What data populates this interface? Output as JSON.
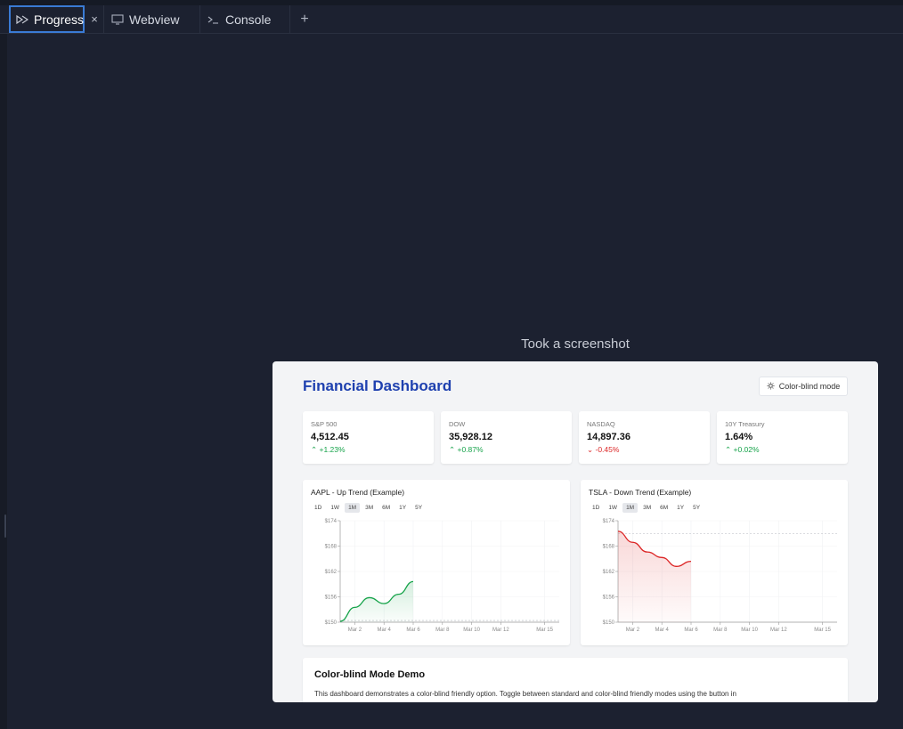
{
  "tabs": {
    "progress": "Progress",
    "webview": "Webview",
    "console": "Console",
    "close": "×",
    "add": "+"
  },
  "caption": "Took a screenshot",
  "dashboard": {
    "title": "Financial Dashboard",
    "colorblind_button": "Color-blind mode",
    "cards": [
      {
        "name": "S&P 500",
        "value": "4,512.45",
        "change": "+1.23%",
        "direction": "up"
      },
      {
        "name": "DOW",
        "value": "35,928.12",
        "change": "+0.87%",
        "direction": "up"
      },
      {
        "name": "NASDAQ",
        "value": "14,897.36",
        "change": "-0.45%",
        "direction": "down"
      },
      {
        "name": "10Y Treasury",
        "value": "1.64%",
        "change": "+0.02%",
        "direction": "up"
      }
    ],
    "ranges": [
      "1D",
      "1W",
      "1M",
      "3M",
      "6M",
      "1Y",
      "5Y"
    ],
    "active_range": "1M",
    "demo_title": "Color-blind Mode Demo",
    "demo_text": "This dashboard demonstrates a color-blind friendly option. Toggle between standard and color-blind friendly modes using the button in"
  },
  "colors": {
    "up": "#16a34a",
    "down": "#dc2626",
    "title": "#1e40af"
  },
  "chart_data": [
    {
      "type": "area",
      "title": "AAPL - Up Trend (Example)",
      "y_ticks": [
        "$174",
        "$168",
        "$162",
        "$156",
        "$150"
      ],
      "x_ticks": [
        "Mar 2",
        "Mar 4",
        "Mar 6",
        "Mar 8",
        "Mar 10",
        "Mar 12",
        "Mar 15"
      ],
      "ylim": [
        150,
        174
      ],
      "x": [
        "Mar 1",
        "Mar 2",
        "Mar 3",
        "Mar 4",
        "Mar 5",
        "Mar 6"
      ],
      "values": [
        150.2,
        153.5,
        155.8,
        154.4,
        156.6,
        159.6
      ],
      "reference_line": 150.4,
      "color": "#16a34a"
    },
    {
      "type": "area",
      "title": "TSLA - Down Trend (Example)",
      "y_ticks": [
        "$174",
        "$168",
        "$162",
        "$156",
        "$150"
      ],
      "x_ticks": [
        "Mar 2",
        "Mar 4",
        "Mar 6",
        "Mar 8",
        "Mar 10",
        "Mar 12",
        "Mar 15"
      ],
      "ylim": [
        150,
        174
      ],
      "x": [
        "Mar 1",
        "Mar 2",
        "Mar 3",
        "Mar 4",
        "Mar 5",
        "Mar 6"
      ],
      "values": [
        171.5,
        168.9,
        166.6,
        165.3,
        163.2,
        164.4
      ],
      "reference_line": 171.0,
      "color": "#dc2626"
    }
  ]
}
